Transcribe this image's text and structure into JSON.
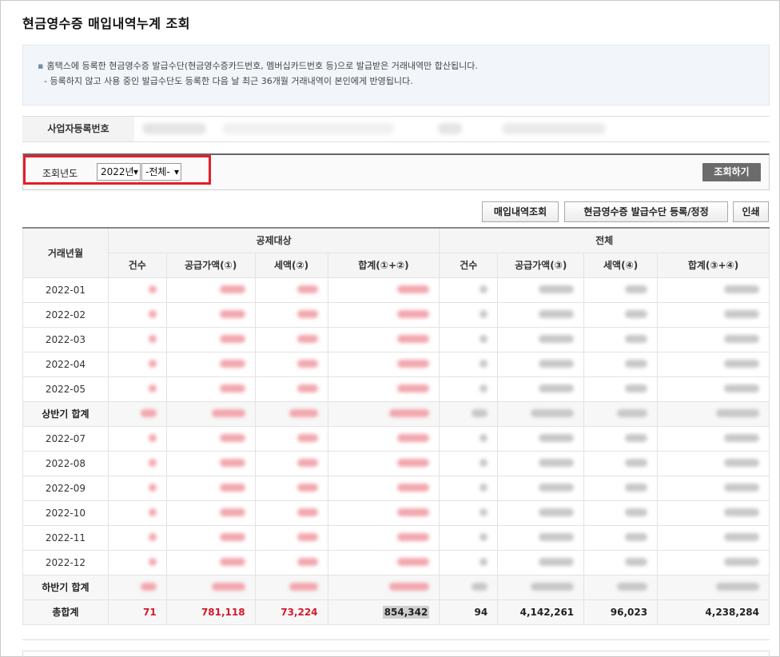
{
  "page": {
    "title": "현금영수증 매입내역누계 조회"
  },
  "notice": {
    "line1": "홈택스에 등록한 현금영수증 발급수단(현금영수증카드번호, 멤버십카드번호 등)으로 발급받은 거래내역만 합산됩니다.",
    "line2": "- 등록하지 않고 사용 중인 발급수단도 등록한 다음 날 최근 36개월 거래내역이 본인에게 반영됩니다."
  },
  "business": {
    "label": "사업자등록번호"
  },
  "search": {
    "label": "조회년도",
    "year_value": "2022년",
    "filter_value": "-전체-",
    "submit_label": "조회하기"
  },
  "actions": {
    "purchase_query": "매입내역조회",
    "register_means": "현금영수증 발급수단 등록/정정",
    "print": "인쇄"
  },
  "table": {
    "header_month": "거래년월",
    "group_deductible": "공제대상",
    "group_all": "전체",
    "cols_deductible": [
      "건수",
      "공급가액(①)",
      "세액(②)",
      "합계(①+②)"
    ],
    "cols_all": [
      "건수",
      "공급가액(③)",
      "세액(④)",
      "합계(③+④)"
    ],
    "rows": [
      {
        "month": "2022-01",
        "subtotal": false
      },
      {
        "month": "2022-02",
        "subtotal": false
      },
      {
        "month": "2022-03",
        "subtotal": false
      },
      {
        "month": "2022-04",
        "subtotal": false
      },
      {
        "month": "2022-05",
        "subtotal": false
      },
      {
        "month": "상반기 합계",
        "subtotal": true
      },
      {
        "month": "2022-07",
        "subtotal": false
      },
      {
        "month": "2022-08",
        "subtotal": false
      },
      {
        "month": "2022-09",
        "subtotal": false
      },
      {
        "month": "2022-10",
        "subtotal": false
      },
      {
        "month": "2022-11",
        "subtotal": false
      },
      {
        "month": "2022-12",
        "subtotal": false
      },
      {
        "month": "하반기 합계",
        "subtotal": true
      }
    ],
    "total": {
      "label": "총합계",
      "d_count": "71",
      "d_supply": "781,118",
      "d_tax": "73,224",
      "d_sum": "854,342",
      "a_count": "94",
      "a_supply": "4,142,261",
      "a_tax": "96,023",
      "a_sum": "4,238,284"
    }
  },
  "colors": {
    "accent_red": "#d6192b",
    "highlight_box": "#e41e2c",
    "search_button": "#6b6b6b"
  }
}
